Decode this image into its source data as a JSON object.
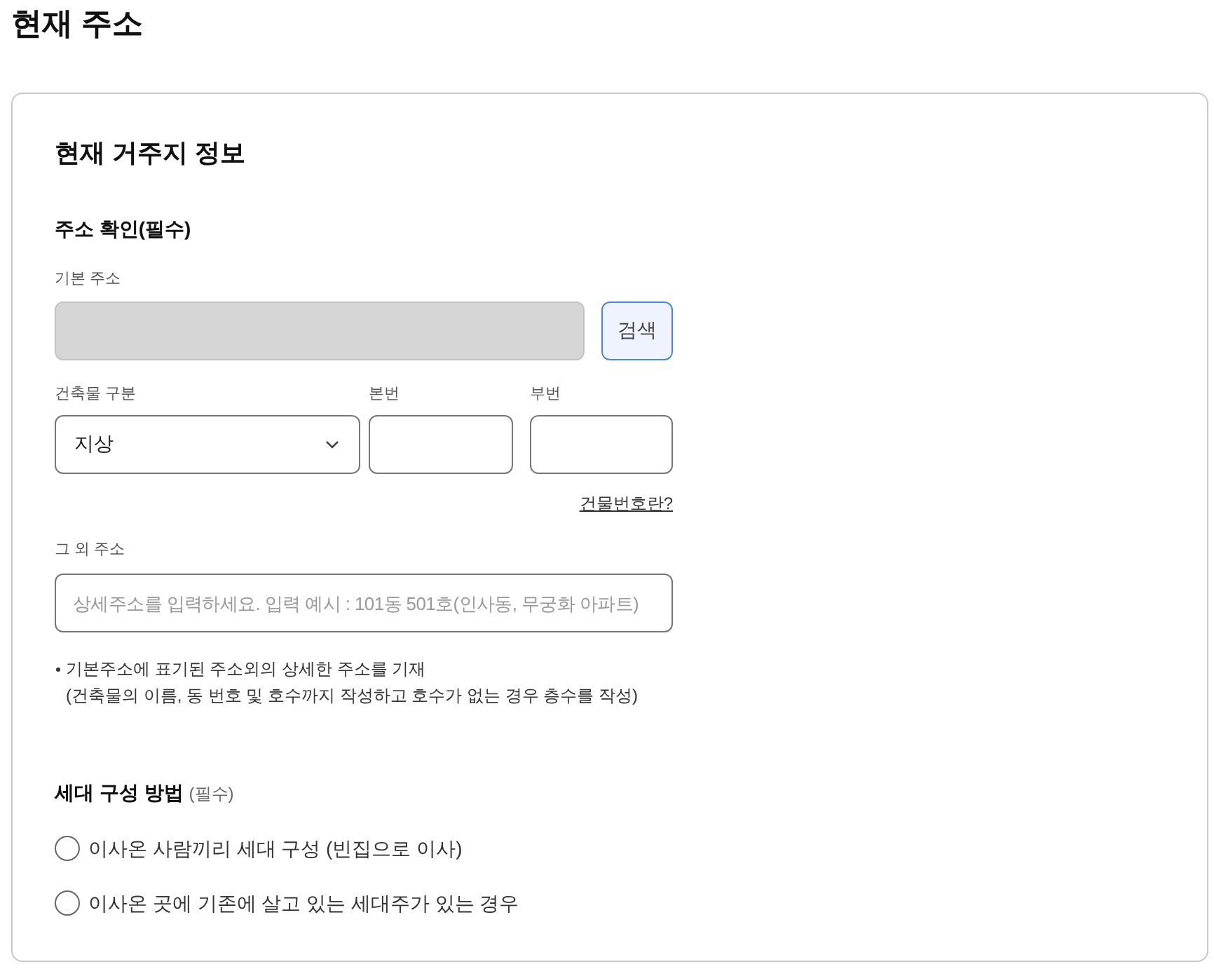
{
  "page": {
    "title": "현재 주소"
  },
  "card": {
    "title": "현재 거주지 정보",
    "address_section": {
      "title": "주소 확인(필수)",
      "base_address": {
        "label": "기본 주소",
        "disabled": true,
        "search_button": "검색"
      },
      "building_type": {
        "label": "건축물 구분",
        "value": "지상"
      },
      "main_number": {
        "label": "본번"
      },
      "sub_number": {
        "label": "부번"
      },
      "help_link": "건물번호란?",
      "extra_address": {
        "label": "그 외 주소",
        "placeholder": "상세주소를 입력하세요. 입력 예시 : 101동 501호(인사동, 무궁화 아파트)"
      },
      "note": "기본주소에 표기된 주소외의 상세한 주소를 기재\n(건축물의 이름, 동 번호 및 호수까지 작성하고 호수가 없는 경우 층수를 작성)"
    },
    "household_section": {
      "title": "세대 구성 방법",
      "required_mark": "(필수)",
      "options": [
        {
          "label": "이사온 사람끼리 세대 구성 (빈집으로 이사)",
          "selected": false
        },
        {
          "label": "이사온 곳에 기존에 살고 있는 세대주가 있는 경우",
          "selected": false
        }
      ]
    }
  }
}
